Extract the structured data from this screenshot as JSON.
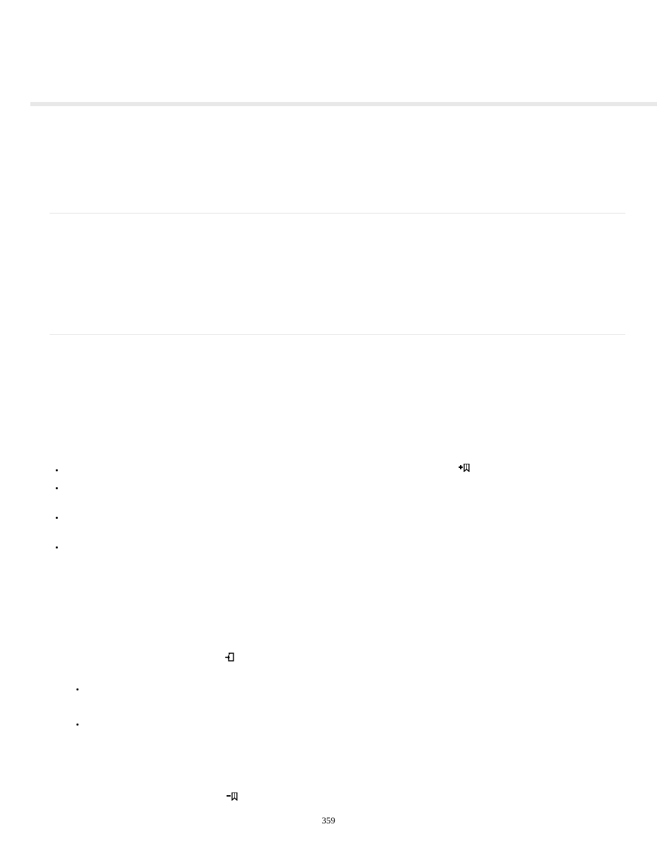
{
  "page_number": "359",
  "icons": {
    "plus_bookmark": "plus-bookmark-icon",
    "arrow_page": "arrow-into-page-icon",
    "minus_bookmark": "minus-bookmark-icon"
  }
}
